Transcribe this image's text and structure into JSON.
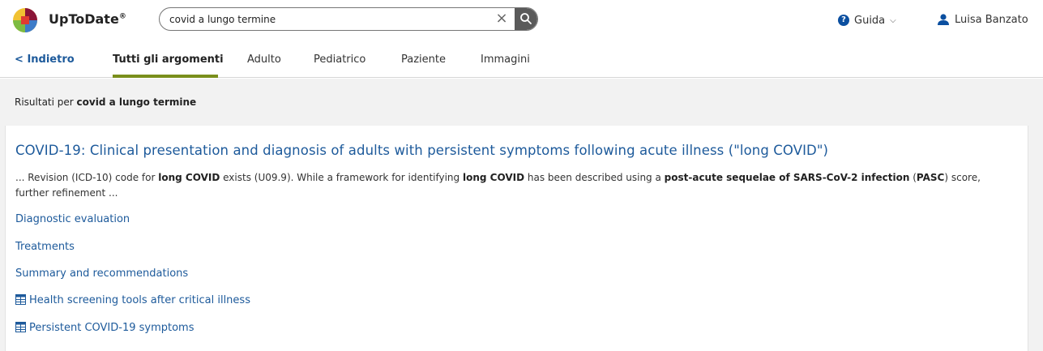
{
  "header": {
    "brand": "UpToDate",
    "brand_mark": "®",
    "search": {
      "value": "covid a lungo termine",
      "clear": "×"
    },
    "help_label": "Guida",
    "user_name": "Luisa Banzato"
  },
  "tabs": {
    "back_label": "Indietro",
    "items": [
      {
        "label": "Tutti gli argomenti"
      },
      {
        "label": "Adulto"
      },
      {
        "label": "Pediatrico"
      },
      {
        "label": "Paziente"
      },
      {
        "label": "Immagini"
      }
    ]
  },
  "results": {
    "prefix": "Risultati per ",
    "query": "covid a lungo termine"
  },
  "result": {
    "title": "COVID-19: Clinical presentation and diagnosis of adults with persistent symptoms following acute illness (\"long COVID\")",
    "snippet": {
      "p1": "... Revision (ICD-10) code for ",
      "b1": "long COVID",
      "p2": " exists (U09.9). While a framework for identifying ",
      "b2": "long COVID",
      "p3": " has been described using a ",
      "b3": "post-acute sequelae of SARS-CoV-2 infection",
      "p4": " (",
      "b4": "PASC",
      "p5": ") score, further refinement ..."
    },
    "links": [
      {
        "label": "Diagnostic evaluation",
        "icon": ""
      },
      {
        "label": "Treatments",
        "icon": ""
      },
      {
        "label": "Summary and recommendations",
        "icon": ""
      },
      {
        "label": "Health screening tools after critical illness",
        "icon": "table-icon"
      },
      {
        "label": "Persistent COVID-19 symptoms",
        "icon": "table-icon"
      }
    ]
  },
  "colors": {
    "link": "#1d5a9b",
    "tab_accent": "#7a8f1c",
    "help_icon": "#0b4fa0"
  }
}
